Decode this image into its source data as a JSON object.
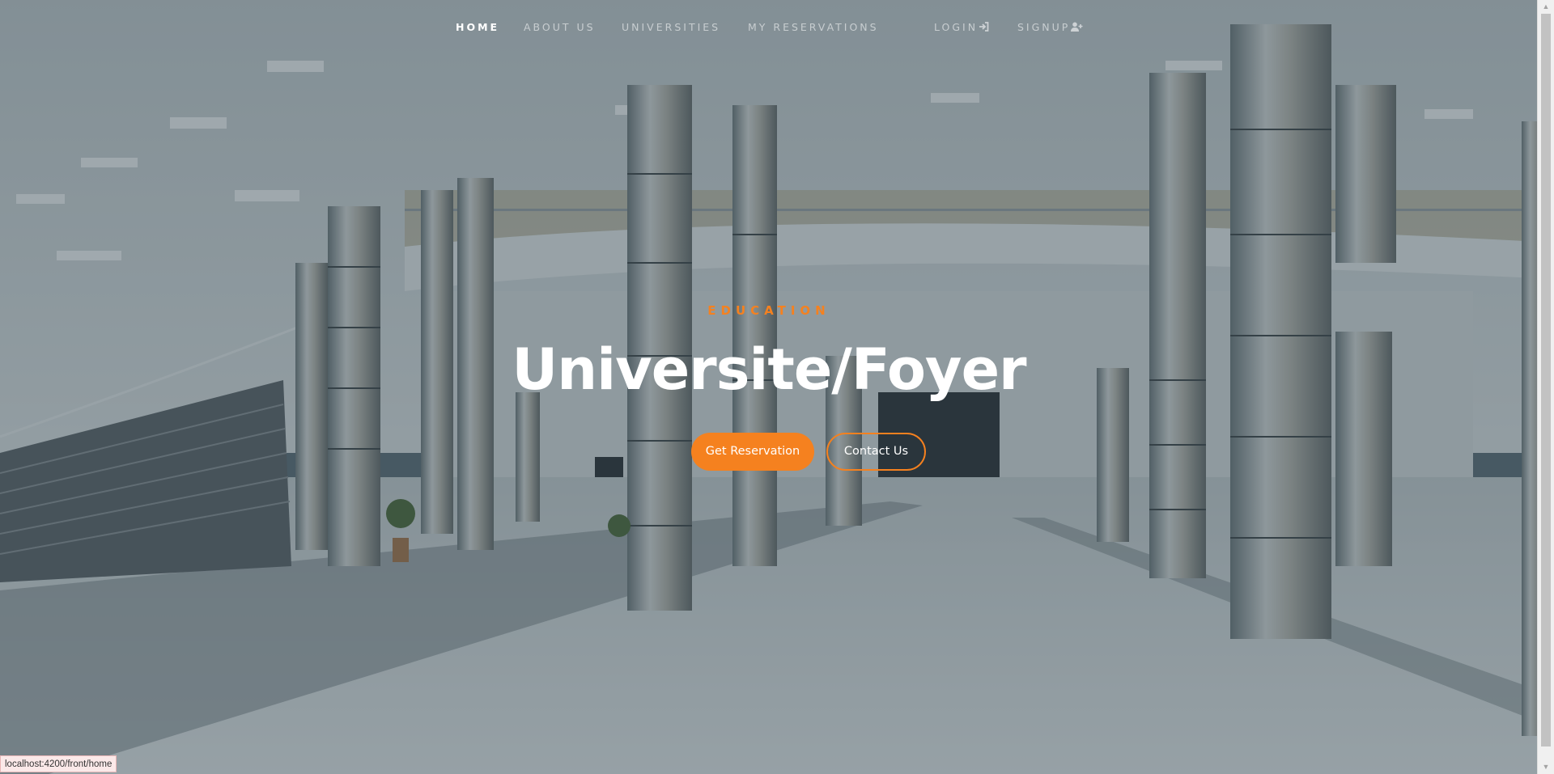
{
  "nav": {
    "items": [
      {
        "label": "HOME",
        "active": true
      },
      {
        "label": "ABOUT US",
        "active": false
      },
      {
        "label": "UNIVERSITIES",
        "active": false
      },
      {
        "label": "MY RESERVATIONS",
        "active": false
      }
    ],
    "login_label": "LOGIN",
    "login_icon": "sign-in-icon",
    "signup_label": "SIGNUP",
    "signup_icon": "user-plus-icon"
  },
  "hero": {
    "kicker": "EDUCATION",
    "title": "Universite/Foyer",
    "primary_button": "Get Reservation",
    "secondary_button": "Contact Us"
  },
  "status_bar": {
    "url": "localhost:4200/front/home"
  },
  "colors": {
    "accent": "#f5811f",
    "text_light": "#ffffff",
    "overlay": "#3d5562"
  }
}
